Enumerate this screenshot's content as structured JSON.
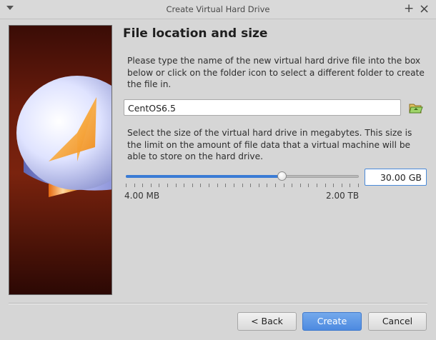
{
  "window": {
    "title": "Create Virtual Hard Drive"
  },
  "page": {
    "heading": "File location and size",
    "location_instructions": "Please type the name of the new virtual hard drive file into the box below or click on the folder icon to select a different folder to create the file in.",
    "file_name": "CentOS6.5",
    "size_instructions": "Select the size of the virtual hard drive in megabytes. This size is the limit on the amount of file data that a virtual machine will be able to store on the hard drive.",
    "size_value": "30.00 GB",
    "slider_fraction": 0.67,
    "slider_min_label": "4.00 MB",
    "slider_max_label": "2.00 TB"
  },
  "buttons": {
    "back": "< Back",
    "create": "Create",
    "cancel": "Cancel"
  },
  "icons": {
    "window_menu": "chevron-down-icon",
    "maximize": "plus-icon",
    "close": "close-icon",
    "folder": "folder-open-icon"
  },
  "colors": {
    "accent": "#4d8ae0",
    "slider_fill": "#3a7bd5",
    "side_background": "#6a1c0c"
  }
}
